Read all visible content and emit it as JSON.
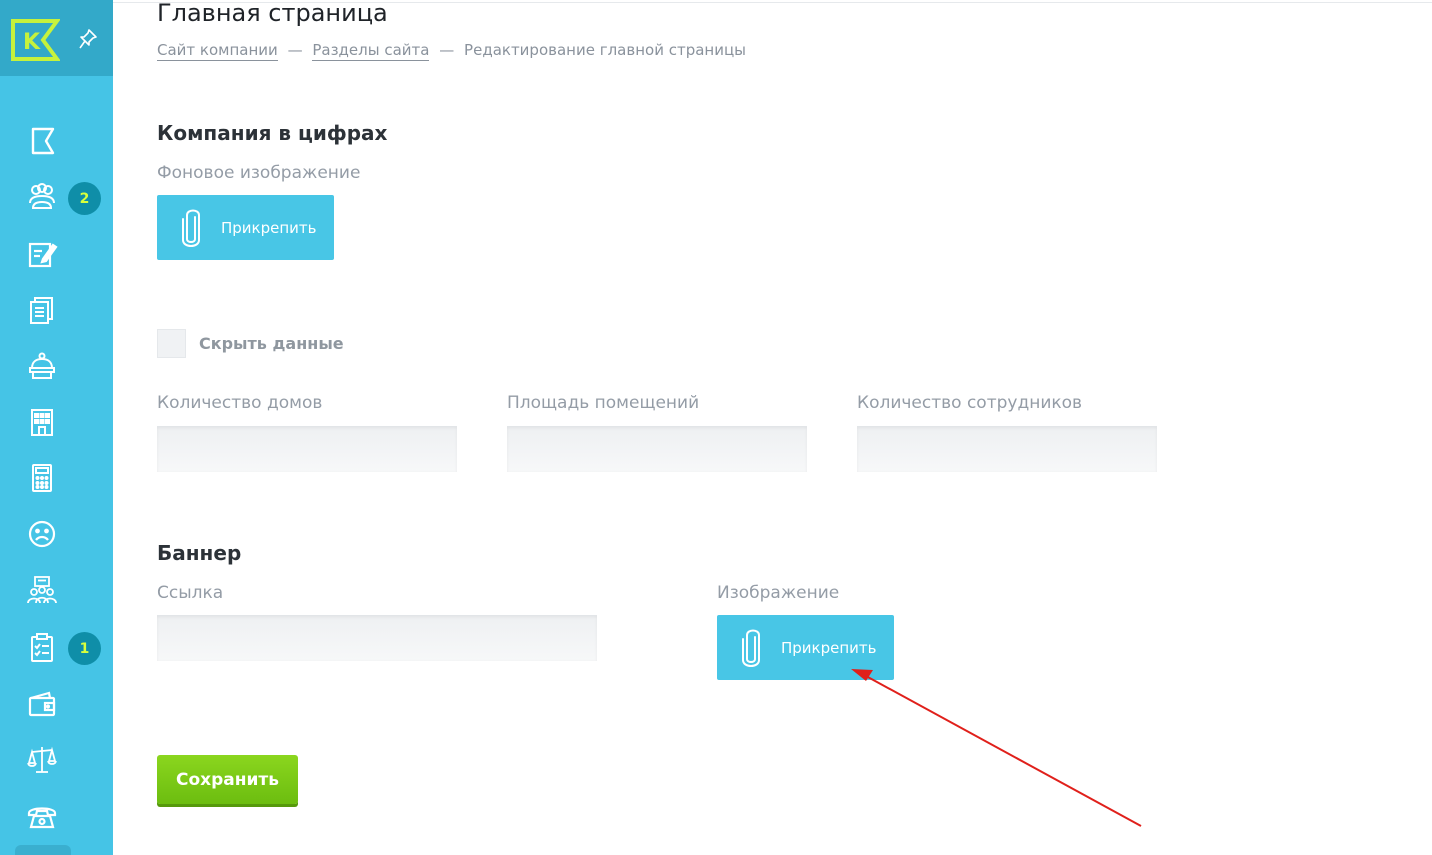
{
  "sidebar": {
    "logo_letter": "K",
    "items": [
      {
        "icon": "flag-icon"
      },
      {
        "icon": "residents-icon",
        "badge": "2"
      },
      {
        "icon": "edit-note-icon"
      },
      {
        "icon": "documents-icon"
      },
      {
        "icon": "reception-bell-icon"
      },
      {
        "icon": "building-icon"
      },
      {
        "icon": "calculator-icon"
      },
      {
        "icon": "sad-face-icon"
      },
      {
        "icon": "meeting-icon"
      },
      {
        "icon": "checklist-icon",
        "badge": "1"
      },
      {
        "icon": "wallet-icon"
      },
      {
        "icon": "scales-icon"
      },
      {
        "icon": "phone-icon"
      }
    ]
  },
  "header": {
    "title": "Главная страница",
    "breadcrumbs": [
      "Сайт компании",
      "Разделы сайта",
      "Редактирование главной страницы"
    ],
    "separator": "—"
  },
  "company_numbers": {
    "title": "Компания в цифрах",
    "background_label": "Фоновое изображение",
    "attach_label": "Прикрепить",
    "hide_label": "Скрыть данные",
    "hide_checked": false,
    "fields": [
      {
        "label": "Количество домов",
        "value": ""
      },
      {
        "label": "Площадь помещений",
        "value": ""
      },
      {
        "label": "Количество сотрудников",
        "value": ""
      }
    ]
  },
  "banner": {
    "title": "Баннер",
    "link_label": "Ссылка",
    "link_value": "",
    "image_label": "Изображение",
    "attach_label": "Прикрепить"
  },
  "save_label": "Сохранить",
  "colors": {
    "sidebar": "#45c4e6",
    "accent": "#48c6e6",
    "save": "#7ac817",
    "badge": "#0f8ea8",
    "logo": "#c6f23c",
    "arrow": "#e0201b"
  }
}
